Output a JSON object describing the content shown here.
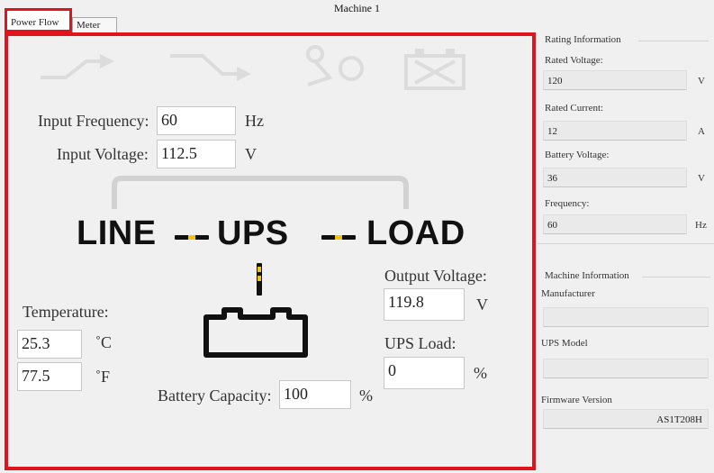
{
  "window": {
    "title": "Machine 1"
  },
  "tabs": [
    {
      "label": "Power Flow"
    },
    {
      "label": "Meter"
    }
  ],
  "power_flow": {
    "input_frequency": {
      "label": "Input Frequency:",
      "value": "60",
      "unit": "Hz"
    },
    "input_voltage": {
      "label": "Input Voltage:",
      "value": "112.5",
      "unit": "V"
    },
    "flow": {
      "line": "LINE",
      "ups": "UPS",
      "load": "LOAD"
    },
    "output_voltage": {
      "label": "Output Voltage:",
      "value": "119.8",
      "unit": "V"
    },
    "ups_load": {
      "label": "UPS Load:",
      "value": "0",
      "unit": "%"
    },
    "temperature": {
      "label": "Temperature:",
      "celsius": "25.3",
      "celsius_unit": "˚C",
      "fahrenheit": "77.5",
      "fahrenheit_unit": "˚F"
    },
    "battery_capacity": {
      "label": "Battery Capacity:",
      "value": "100",
      "unit": "%"
    },
    "status_icons": [
      "bypass-line-icon",
      "ups-flow-icon",
      "fault-icon",
      "battery-warning-icon"
    ]
  },
  "rating_information": {
    "title": "Rating Information",
    "rated_voltage": {
      "label": "Rated Voltage:",
      "value": "120",
      "unit": "V"
    },
    "rated_current": {
      "label": "Rated Current:",
      "value": "12",
      "unit": "A"
    },
    "battery_voltage": {
      "label": "Battery Voltage:",
      "value": "36",
      "unit": "V"
    },
    "frequency": {
      "label": "Frequency:",
      "value": "60",
      "unit": "Hz"
    }
  },
  "machine_information": {
    "title": "Machine Information",
    "manufacturer": {
      "label": "Manufacturer",
      "value": ""
    },
    "ups_model": {
      "label": "UPS Model",
      "value": ""
    },
    "firmware_version": {
      "label": "Firmware Version",
      "value": "AS1T208H"
    }
  },
  "colors": {
    "highlight": "#e0141c",
    "flow_indicator": "#f1c40f",
    "icon_inactive": "#dcdcdc"
  }
}
